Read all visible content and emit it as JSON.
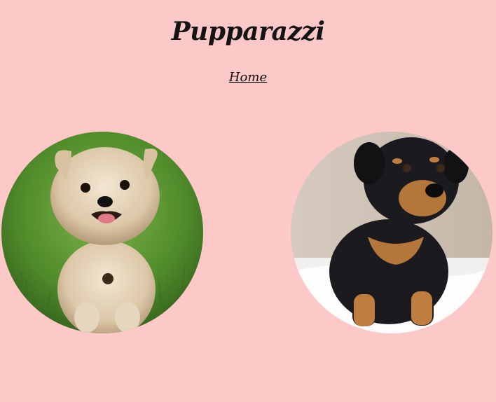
{
  "header": {
    "title": "Pupparazzi"
  },
  "nav": {
    "home_label": "Home"
  },
  "gallery": {
    "photos": [
      {
        "subject": "yorkshire-terrier-on-grass"
      },
      {
        "subject": "rottweiler-puppy-sitting"
      }
    ]
  },
  "colors": {
    "background": "#fdc8c8",
    "text": "#141414"
  }
}
